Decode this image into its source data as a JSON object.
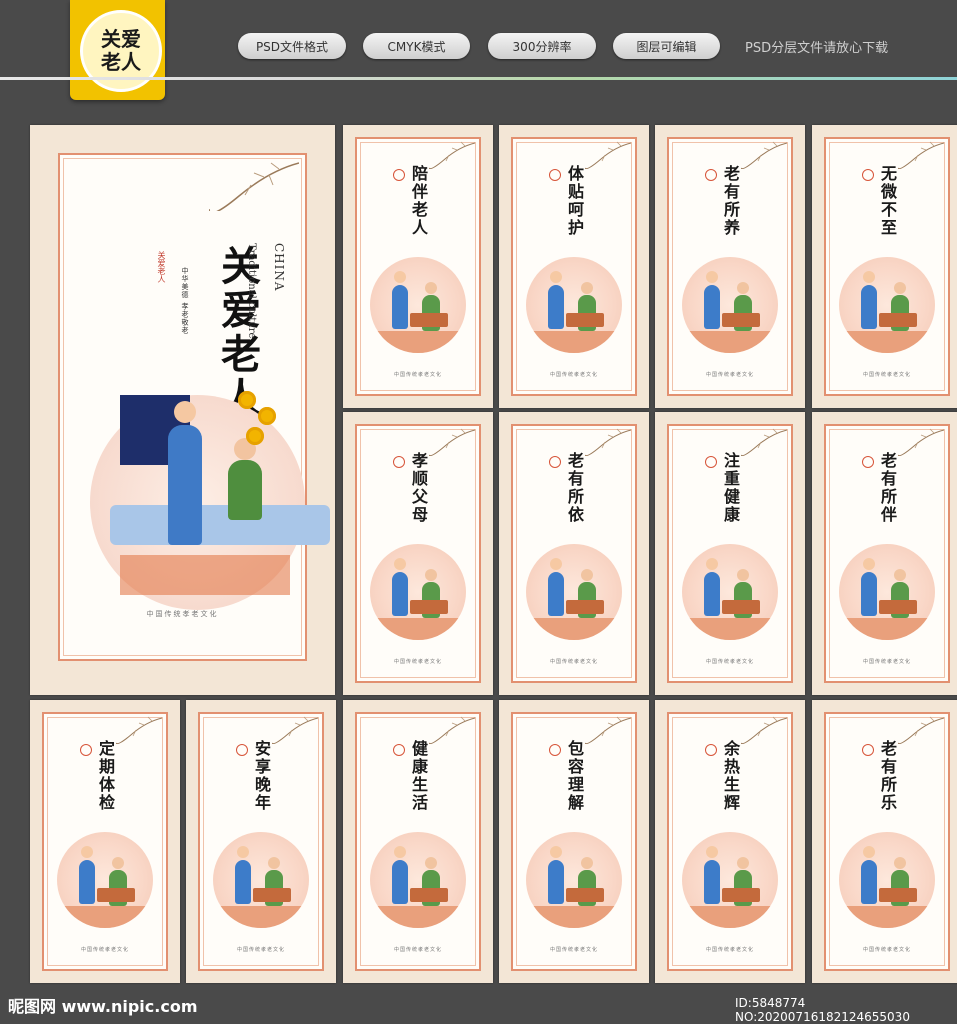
{
  "header": {
    "badge_line1": "关爱",
    "badge_line2": "老人",
    "pills": [
      "PSD文件格式",
      "CMYK模式",
      "300分辨率",
      "图层可编辑"
    ],
    "tagline": "PSD分层文件请放心下载"
  },
  "main_poster": {
    "title": "关爱老人",
    "seal_text": "关爱老人",
    "sub_text": "中华美德 孝老敬老",
    "en_line1": "Traditional culture",
    "en_line2": "CHINA",
    "footer": "中国传统孝老文化"
  },
  "posters": [
    {
      "title": "陪伴老人"
    },
    {
      "title": "体贴呵护"
    },
    {
      "title": "老有所养"
    },
    {
      "title": "无微不至"
    },
    {
      "title": "孝顺父母"
    },
    {
      "title": "老有所依"
    },
    {
      "title": "注重健康"
    },
    {
      "title": "老有所伴"
    },
    {
      "title": "定期体检"
    },
    {
      "title": "安享晚年"
    },
    {
      "title": "健康生活"
    },
    {
      "title": "包容理解"
    },
    {
      "title": "余热生辉"
    },
    {
      "title": "老有所乐"
    }
  ],
  "poster_footer": "中国传统孝老文化",
  "watermark": {
    "left": "昵图网 www.nipic.com",
    "right": "ID:5848774 NO:20200716182124655030"
  }
}
